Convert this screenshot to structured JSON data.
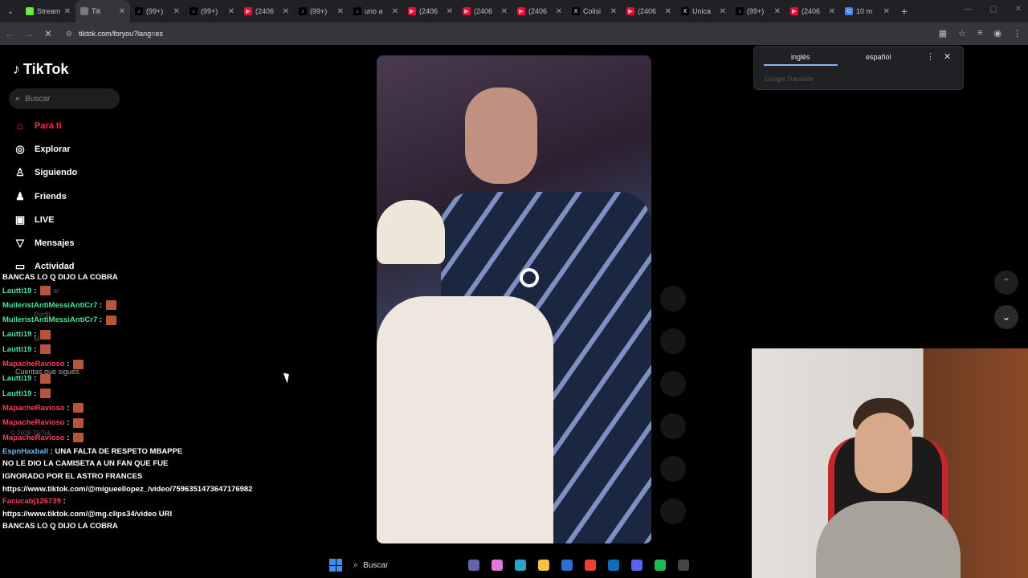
{
  "browser": {
    "tabs": [
      {
        "title": "Stream",
        "favicon_color": "#53fc18",
        "favicon": "K"
      },
      {
        "title": "Tik",
        "favicon_color": "#777777",
        "favicon": "◌",
        "active": true
      },
      {
        "title": "(99+)",
        "favicon_color": "#000000",
        "favicon": "♪"
      },
      {
        "title": "(99+)",
        "favicon_color": "#000000",
        "favicon": "♪"
      },
      {
        "title": "(2406",
        "favicon_color": "#ff0033",
        "favicon": "▶"
      },
      {
        "title": "(99+)",
        "favicon_color": "#000000",
        "favicon": "♪"
      },
      {
        "title": "uno a",
        "favicon_color": "#000000",
        "favicon": "♪"
      },
      {
        "title": "(2406",
        "favicon_color": "#ff0033",
        "favicon": "▶"
      },
      {
        "title": "(2406",
        "favicon_color": "#ff0033",
        "favicon": "▶"
      },
      {
        "title": "(2406",
        "favicon_color": "#ff0033",
        "favicon": "▶"
      },
      {
        "title": "Colisi",
        "favicon_color": "#000000",
        "favicon": "X"
      },
      {
        "title": "(2406",
        "favicon_color": "#ff0033",
        "favicon": "▶"
      },
      {
        "title": "Unica",
        "favicon_color": "#000000",
        "favicon": "X"
      },
      {
        "title": "(99+)",
        "favicon_color": "#000000",
        "favicon": "♪"
      },
      {
        "title": "(2406",
        "favicon_color": "#ff0033",
        "favicon": "▶"
      },
      {
        "title": "10 m",
        "favicon_color": "#4285f4",
        "favicon": "G"
      }
    ],
    "url": "tiktok.com/foryou?lang=es"
  },
  "sidebar": {
    "logo_text": "TikTok",
    "search_placeholder": "Buscar",
    "nav": [
      {
        "label": "Para ti",
        "icon": "home-icon",
        "glyph": "⌂",
        "active": true
      },
      {
        "label": "Explorar",
        "icon": "compass-icon",
        "glyph": "◎"
      },
      {
        "label": "Siguiendo",
        "icon": "following-icon",
        "glyph": "♙"
      },
      {
        "label": "Friends",
        "icon": "friends-icon",
        "glyph": "♟"
      },
      {
        "label": "LIVE",
        "icon": "live-icon",
        "glyph": "▣"
      },
      {
        "label": "Mensajes",
        "icon": "messages-icon",
        "glyph": "▽"
      },
      {
        "label": "Actividad",
        "icon": "activity-icon",
        "glyph": "▭"
      }
    ],
    "faint_items": {
      "cargar": "ar",
      "perfil": "Perfil",
      "mas": "M",
      "following_accounts": "Cuentas que sigues",
      "footer": "© 2026 TikTok"
    }
  },
  "chat": [
    {
      "name": "",
      "class": "name-green",
      "text": "BANCAS LO Q DIJO LA COBRA",
      "emote": false
    },
    {
      "name": "Lautti19",
      "class": "name-green",
      "text": "",
      "emote": true
    },
    {
      "name": "MulleristAntiMessiAntiCr7",
      "class": "name-green",
      "text": "",
      "emote": true
    },
    {
      "name": "MulleristAntiMessiAntiCr7",
      "class": "name-green",
      "text": "",
      "emote": true
    },
    {
      "name": "Lautti19",
      "class": "name-green",
      "text": "",
      "emote": true
    },
    {
      "name": "Lautti19",
      "class": "name-green",
      "text": "",
      "emote": true
    },
    {
      "name": "MapacheRavioso",
      "class": "name-red",
      "text": "",
      "emote": true
    },
    {
      "name": "Lautti19",
      "class": "name-green",
      "text": "",
      "emote": true
    },
    {
      "name": "Lautti19",
      "class": "name-green",
      "text": "",
      "emote": true
    },
    {
      "name": "MapacheRavioso",
      "class": "name-red",
      "text": "",
      "emote": true
    },
    {
      "name": "MapacheRavioso",
      "class": "name-red",
      "text": "",
      "emote": true
    },
    {
      "name": "MapacheRavioso",
      "class": "name-red",
      "text": "",
      "emote": true
    },
    {
      "name": "EspnHaxball",
      "class": "name-blue",
      "text": "UNA FALTA DE RESPETO MBAPPE NO LE DIO LA CAMISETA A UN FAN QUE FUE IGNORADO POR EL ASTRO FRANCES https://www.tiktok.com/@migueellopez_/video/7596351473647176982",
      "emote": false
    },
    {
      "name": "Facucabj126739",
      "class": "name-red",
      "text": "https://www.tiktok.com/@mg.clips34/video URI BANCAS LO Q DIJO LA COBRA",
      "emote": false
    }
  ],
  "translate": {
    "lang_from": "inglés",
    "lang_to": "español",
    "brand": "Google Translate"
  },
  "taskbar": {
    "search_label": "Buscar",
    "apps": [
      {
        "name": "teams-icon",
        "color": "#6264a7"
      },
      {
        "name": "copilot-icon",
        "color": "#e07ad8"
      },
      {
        "name": "edge-icon",
        "color": "#2aa4c9"
      },
      {
        "name": "explorer-icon",
        "color": "#f5c242"
      },
      {
        "name": "store-icon",
        "color": "#2f6fd3"
      },
      {
        "name": "chrome-icon",
        "color": "#e94235"
      },
      {
        "name": "outlook-icon",
        "color": "#0f6cbd"
      },
      {
        "name": "discord-icon",
        "color": "#5865f2"
      },
      {
        "name": "spotify-icon",
        "color": "#1db954"
      },
      {
        "name": "obs-icon",
        "color": "#444444"
      }
    ]
  },
  "colors": {
    "accent": "#fe2c55",
    "background": "#000000"
  }
}
